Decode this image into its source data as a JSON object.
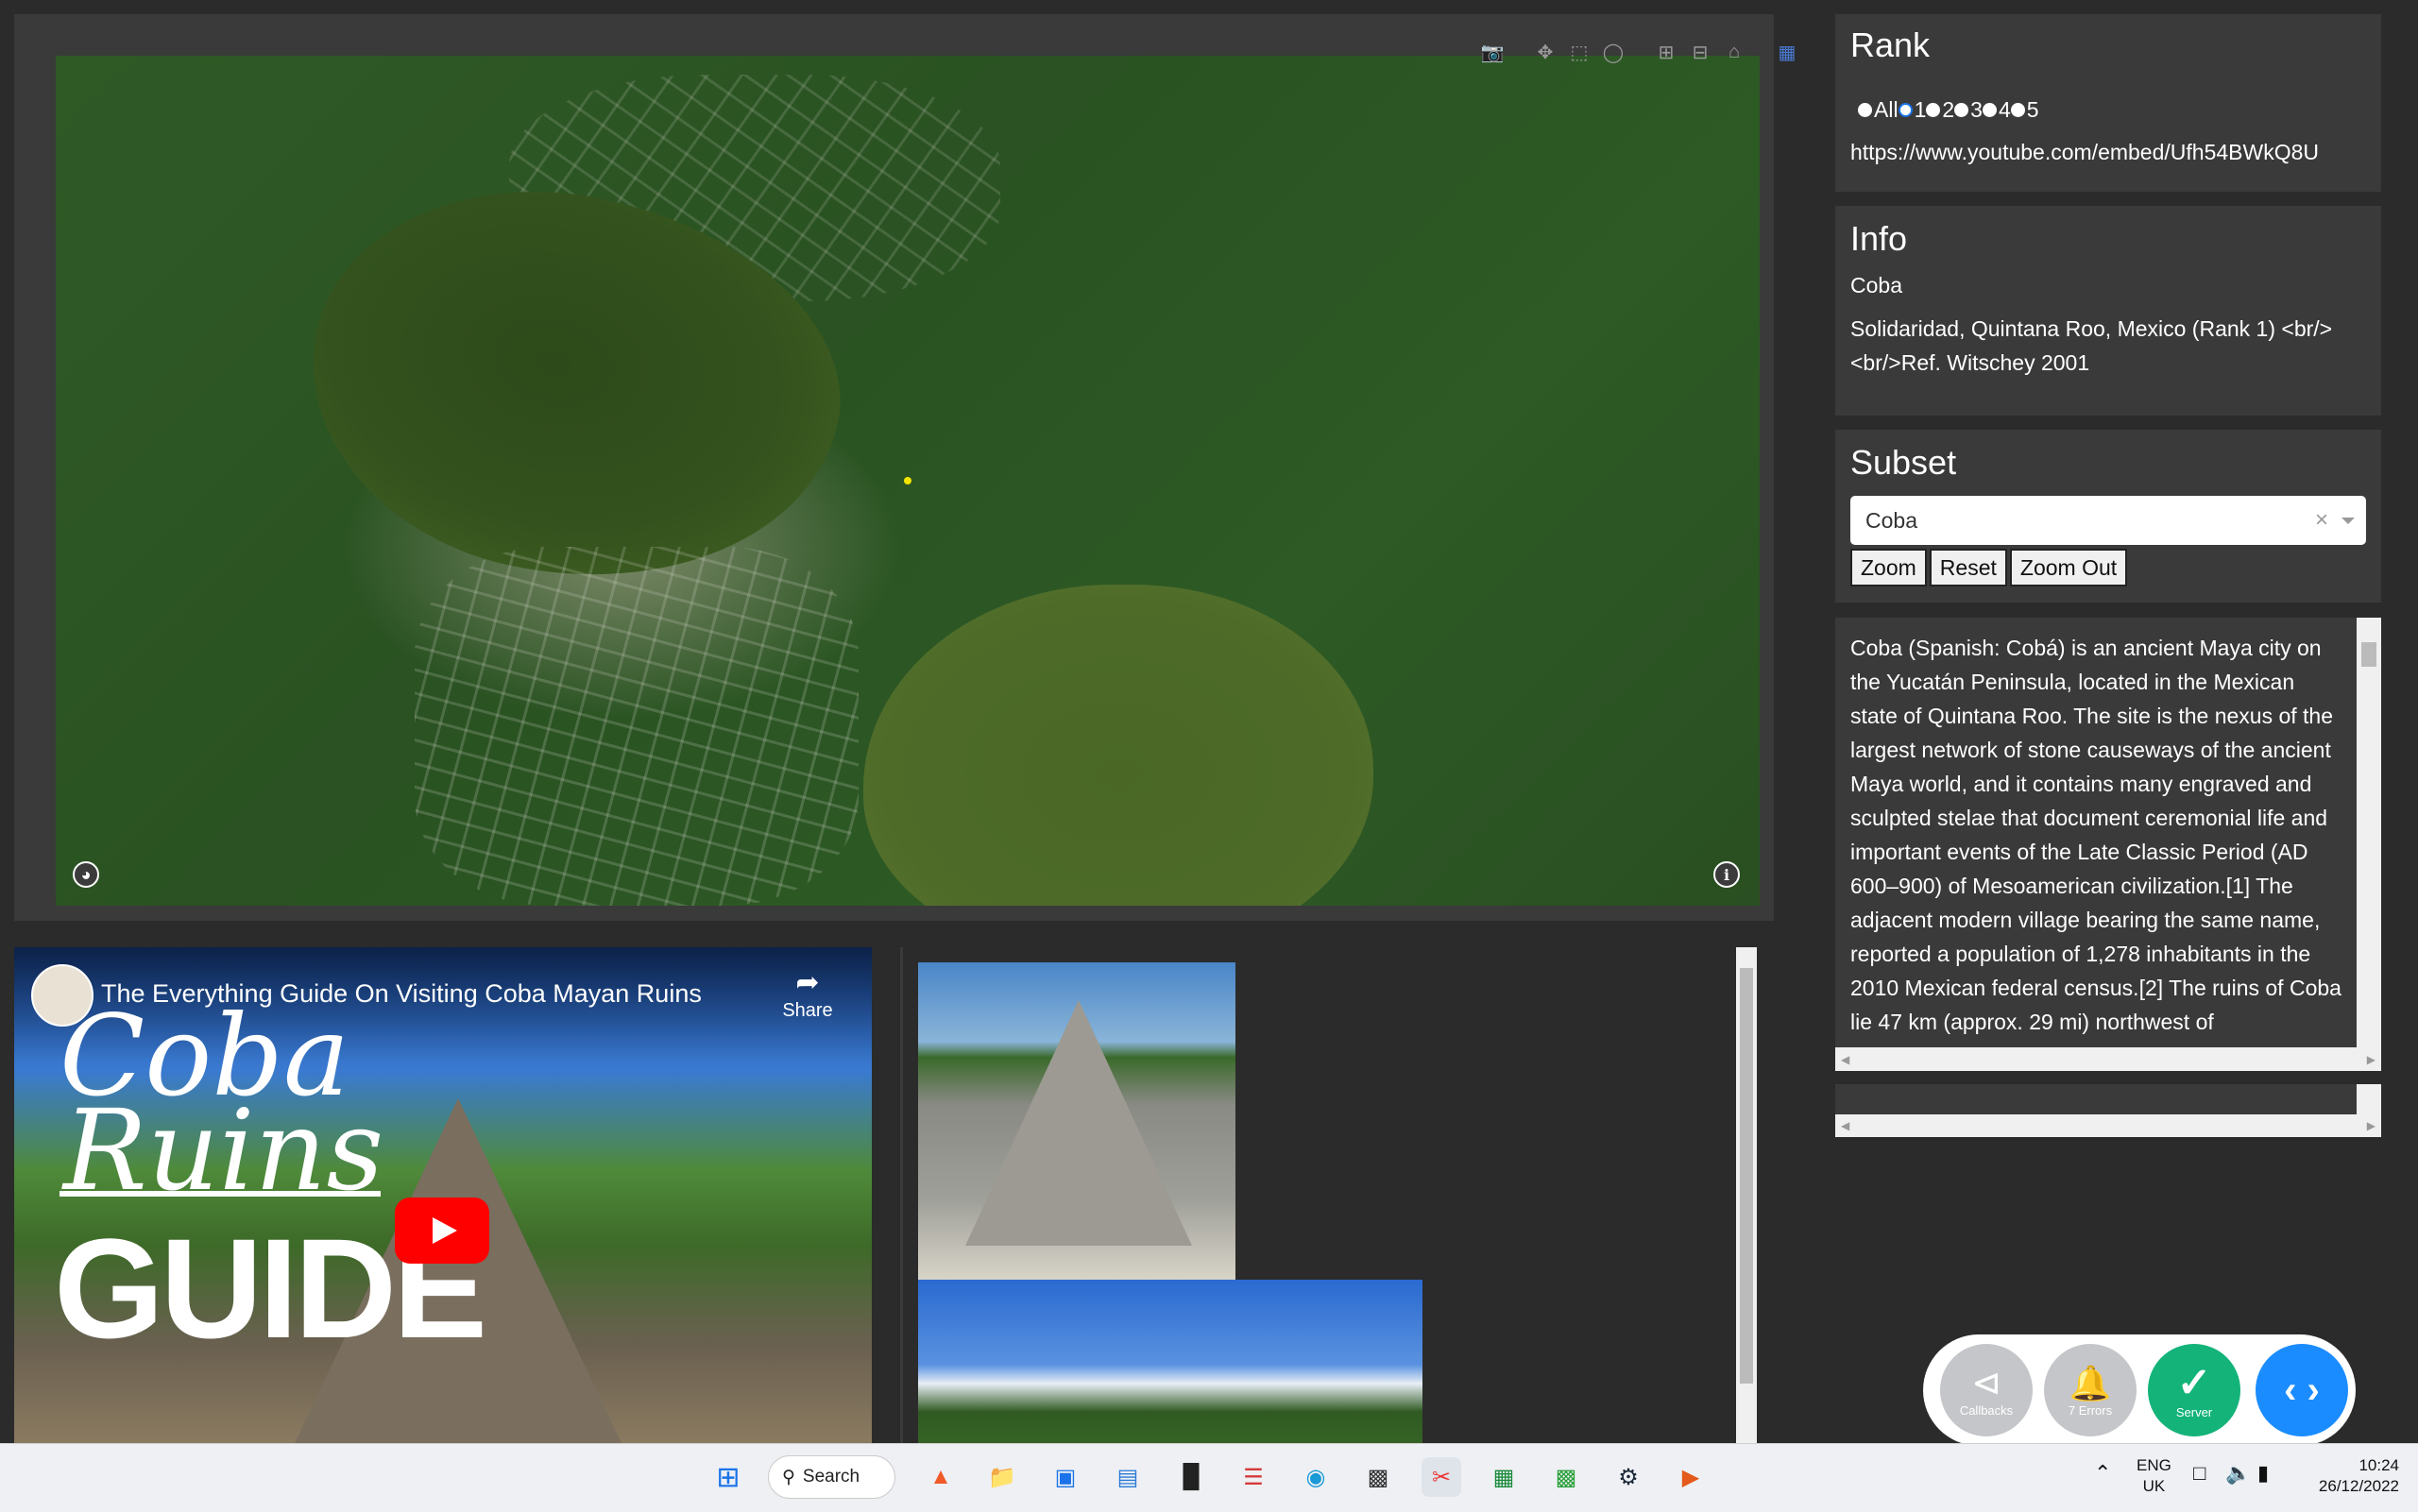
{
  "map": {
    "modebar": [
      "camera-icon",
      "pan-icon",
      "box-select-icon",
      "lasso-icon",
      "zoom-in-icon",
      "zoom-out-icon",
      "home-icon",
      "plotly-logo-icon"
    ]
  },
  "rank": {
    "title": "Rank",
    "options": [
      "All",
      "1",
      "2",
      "3",
      "4",
      "5"
    ],
    "selected": "1",
    "url": "https://www.youtube.com/embed/Ufh54BWkQ8U"
  },
  "info": {
    "title": "Info",
    "name": "Coba",
    "details_line1": "Solidaridad, Quintana Roo, Mexico (Rank 1) <br/>",
    "details_line2": "<br/>Ref. Witschey 2001"
  },
  "subset": {
    "title": "Subset",
    "selected": "Coba",
    "buttons": {
      "zoom": "Zoom",
      "reset": "Reset",
      "zoom_out": "Zoom Out"
    }
  },
  "description": "Coba (Spanish: Cobá) is an ancient Maya city on the Yucatán Peninsula, located in the Mexican state of Quintana Roo. The site is the nexus of the largest network of stone causeways of the ancient Maya world, and it contains many engraved and sculpted stelae that document ceremonial life and important events of the Late Classic Period (AD 600–900) of Mesoamerican civilization.[1] The adjacent modern village bearing the same name, reported a population of 1,278 inhabitants in the 2010 Mexican federal census.[2] The ruins of Coba lie 47 km (approx. 29 mi) northwest of",
  "video": {
    "title": "The Everything Guide On Visiting Coba Mayan Ruins",
    "share": "Share",
    "thumb_word1": "Coba",
    "thumb_word2": "Ruins",
    "thumb_word3": "GUIDE"
  },
  "fab": {
    "callbacks": "Callbacks",
    "errors": "7 Errors",
    "server": "Server"
  },
  "taskbar": {
    "search": "Search",
    "lang1": "ENG",
    "lang2": "UK",
    "time": "10:24",
    "date": "26/12/2022"
  },
  "colors": {
    "panel": "#3a3a3a",
    "background": "#2b2b2b",
    "server_green": "#13b37a",
    "devtools_blue": "#1a8cff",
    "fab_grey": "#c4c6c9"
  }
}
